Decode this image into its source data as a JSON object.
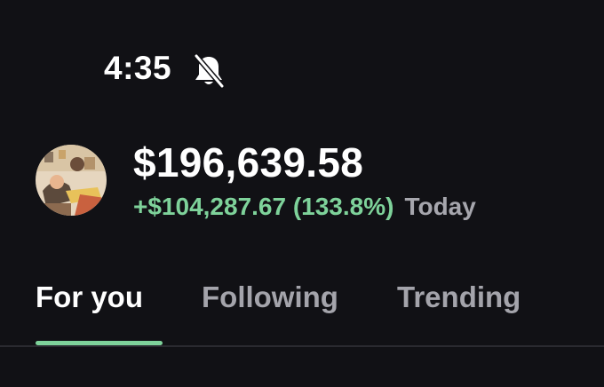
{
  "status_bar": {
    "time": "4:35",
    "icon": "bell-slash-icon"
  },
  "profile": {
    "avatar_icon": "avatar-illustration"
  },
  "portfolio": {
    "balance": "$196,639.58",
    "change": "+$104,287.67 (133.8%)",
    "period": "Today"
  },
  "tabs": [
    {
      "label": "For you",
      "active": true
    },
    {
      "label": "Following",
      "active": false
    },
    {
      "label": "Trending",
      "active": false
    }
  ],
  "colors": {
    "background": "#111115",
    "accent_green": "#7ed29a",
    "muted_text": "#a4a4ab"
  }
}
